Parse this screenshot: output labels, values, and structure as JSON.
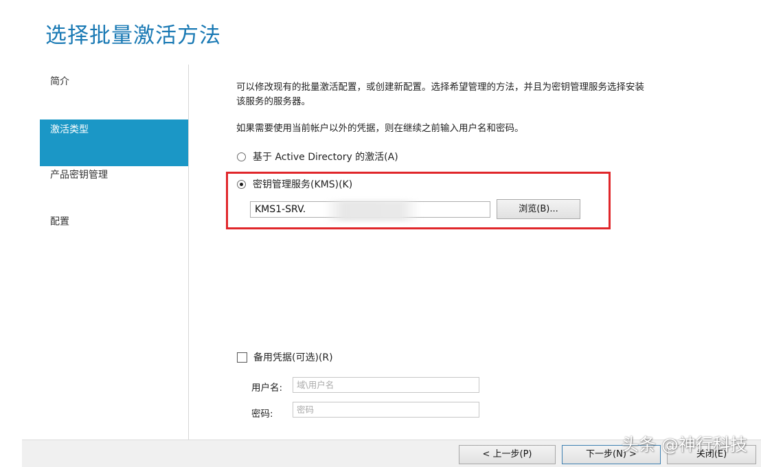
{
  "title": "选择批量激活方法",
  "sidebar": {
    "items": [
      {
        "label": "简介",
        "active": false
      },
      {
        "label": "激活类型",
        "active": true
      },
      {
        "label": "产品密钥管理",
        "active": false
      },
      {
        "label": "配置",
        "active": false
      }
    ]
  },
  "main": {
    "description_line1": "可以修改现有的批量激活配置，或创建新配置。选择希望管理的方法，并且为密钥管理服务选择安装",
    "description_line2": "该服务的服务器。",
    "credentials_hint": "如果需要使用当前帐户以外的凭据，则在继续之前输入用户名和密码。",
    "radio_ad": {
      "label": "基于 Active Directory 的激活(A)",
      "checked": false
    },
    "radio_kms": {
      "label": "密钥管理服务(KMS)(K)",
      "checked": true
    },
    "server_value": "KMS1-SRV.",
    "browse_label": "浏览(B)...",
    "alt_credentials": {
      "label": "备用凭据(可选)(R)",
      "checked": false
    },
    "username_label": "用户名:",
    "username_placeholder": "域\\用户名",
    "password_label": "密码:",
    "password_placeholder": "密码"
  },
  "footer": {
    "prev_label": "< 上一步(P)",
    "next_label": "下一步(N) >",
    "close_label": "关闭(E)"
  },
  "watermark": "头条 @神行科技",
  "colors": {
    "title": "#1979b4",
    "sidebar_active": "#1b97c6",
    "highlight": "#e0262a"
  }
}
